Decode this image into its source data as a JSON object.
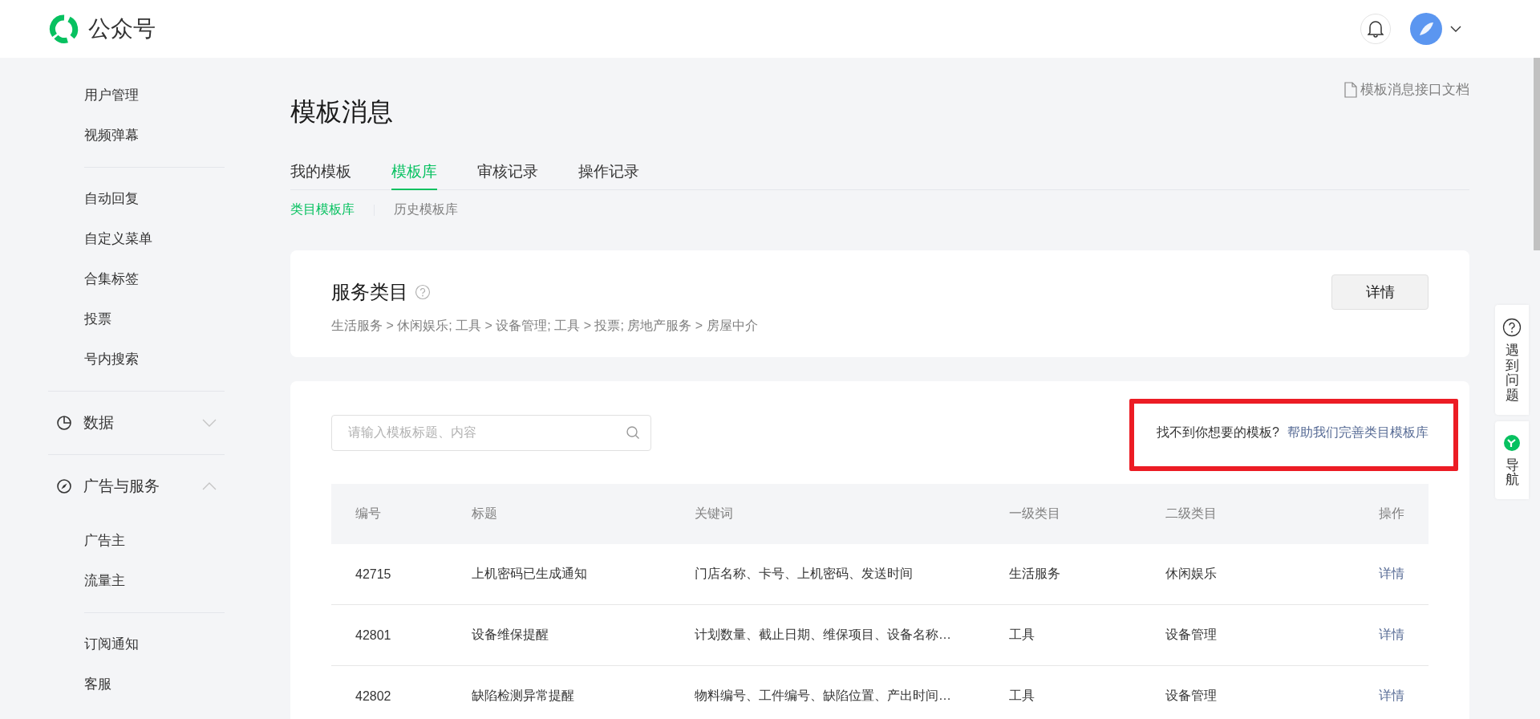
{
  "header": {
    "logo_text": "公众号"
  },
  "sidebar": [
    {
      "kind": "group",
      "items": [
        "用户管理",
        "视频弹幕"
      ]
    },
    {
      "kind": "group",
      "items": [
        "自动回复",
        "自定义菜单",
        "合集标签",
        "投票",
        "号内搜索"
      ]
    },
    {
      "kind": "section",
      "label": "数据",
      "expanded": false
    },
    {
      "kind": "section",
      "label": "广告与服务",
      "expanded": true
    },
    {
      "kind": "group",
      "items": [
        "广告主",
        "流量主"
      ]
    },
    {
      "kind": "group",
      "items": [
        "订阅通知",
        "客服"
      ]
    }
  ],
  "page": {
    "title": "模板消息",
    "doc_link": "模板消息接口文档",
    "tabs": [
      {
        "label": "我的模板",
        "selected": false
      },
      {
        "label": "模板库",
        "selected": true
      },
      {
        "label": "审核记录",
        "selected": false
      },
      {
        "label": "操作记录",
        "selected": false
      }
    ],
    "subtabs": [
      {
        "label": "类目模板库",
        "selected": true
      },
      {
        "label": "历史模板库",
        "selected": false
      }
    ],
    "category_card": {
      "title": "服务类目",
      "path": "生活服务 > 休闲娱乐; 工具 > 设备管理; 工具 > 投票; 房地产服务 > 房屋中介",
      "button": "详情"
    },
    "search": {
      "placeholder": "请输入模板标题、内容"
    },
    "help": {
      "prompt": "找不到你想要的模板?",
      "link": "帮助我们完善类目模板库"
    },
    "table": {
      "columns": [
        "编号",
        "标题",
        "关键词",
        "一级类目",
        "二级类目",
        "操作"
      ],
      "rows": [
        [
          "42715",
          "上机密码已生成通知",
          "门店名称、卡号、上机密码、发送时间",
          "生活服务",
          "休闲娱乐",
          "详情"
        ],
        [
          "42801",
          "设备维保提醒",
          "计划数量、截止日期、维保项目、设备名称…",
          "工具",
          "设备管理",
          "详情"
        ],
        [
          "42802",
          "缺陷检测异常提醒",
          "物料编号、工件编号、缺陷位置、产出时间…",
          "工具",
          "设备管理",
          "详情"
        ]
      ]
    }
  },
  "float_panel": {
    "help": "遇到问题",
    "nav": "导航"
  }
}
